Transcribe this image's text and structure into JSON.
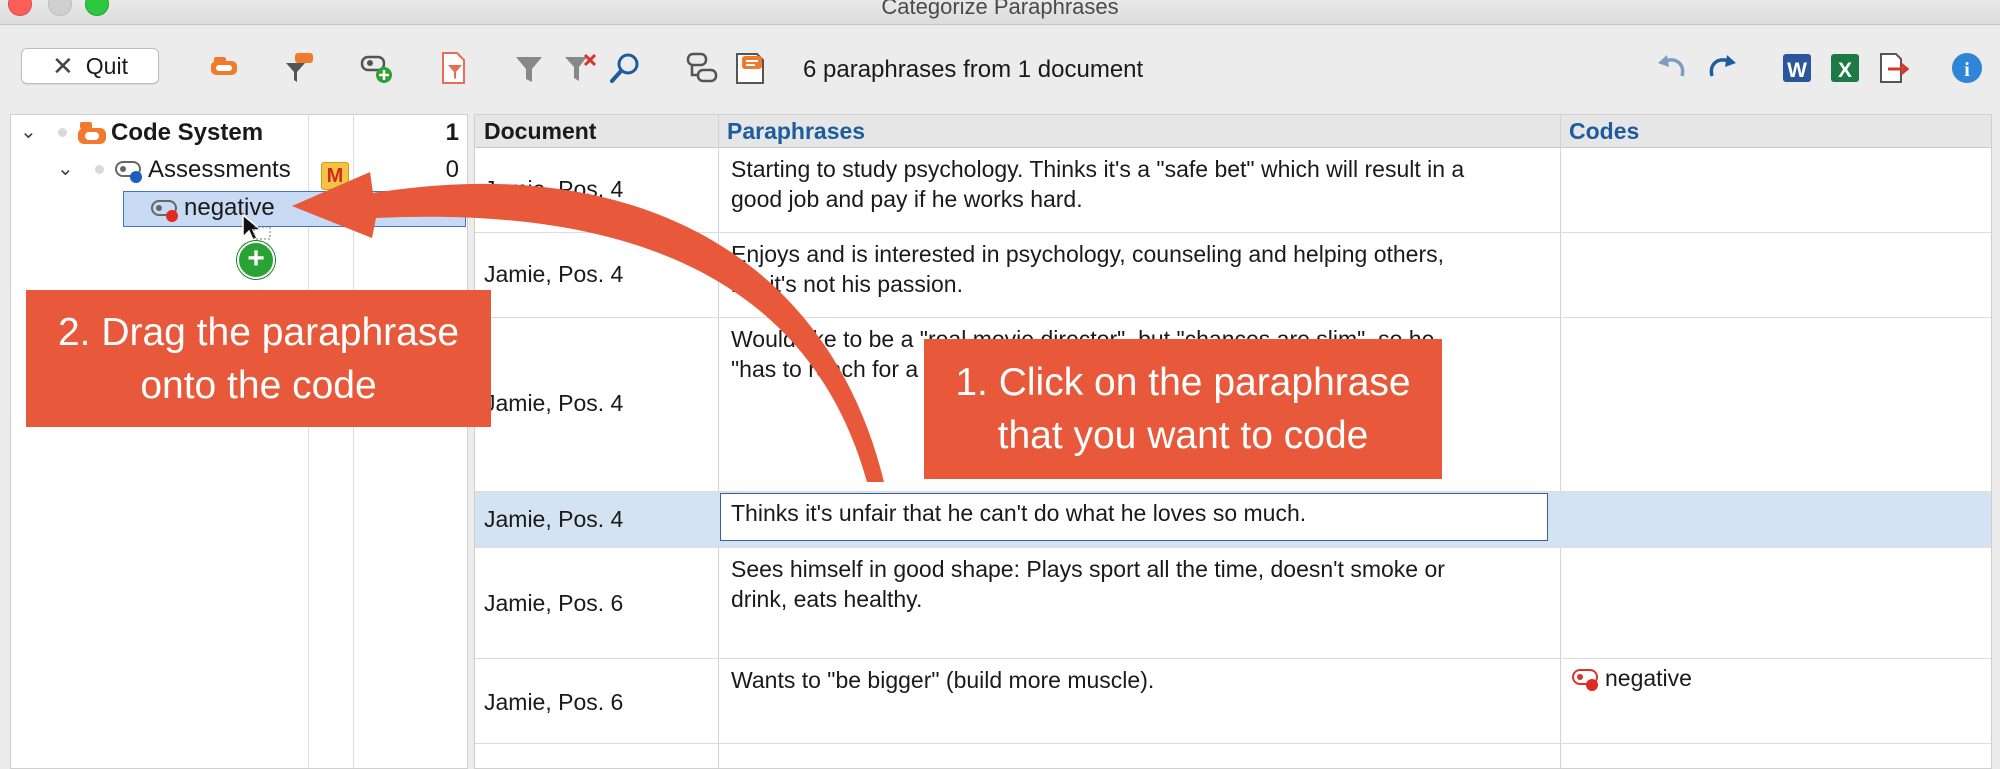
{
  "window": {
    "title": "Categorize Paraphrases"
  },
  "toolbar": {
    "quit_label": "Quit",
    "status": "6 paraphrases from 1 document",
    "icons": [
      "code-system-icon",
      "paraphrase-filter-icon",
      "new-code-icon",
      "document-filter-icon",
      "filter-icon",
      "clear-filter-icon",
      "search-icon",
      "code-link-icon",
      "paraphrase-doc-icon",
      "undo-icon",
      "redo-icon",
      "word-export-icon",
      "excel-export-icon",
      "export-icon",
      "info-icon"
    ],
    "accent_colors": {
      "orange": "#e8583a",
      "blue": "#1d5d9e",
      "word": "#2b579a",
      "excel": "#1d7a44"
    }
  },
  "code_system": {
    "root": {
      "label": "Code System",
      "count": "1"
    },
    "assessments": {
      "label": "Assessments",
      "badge": "M",
      "count": "0"
    },
    "negative": {
      "label": "negative",
      "count": "1"
    }
  },
  "table": {
    "headers": {
      "document": "Document",
      "paraphrases": "Paraphrases",
      "codes": "Codes"
    },
    "rows": [
      {
        "document": "Jamie, Pos. 4",
        "paraphrase_l1": "Starting to study psychology. Thinks it's a \"safe bet\" which will result in a",
        "paraphrase_l2": "good job and pay if he works hard.",
        "code": ""
      },
      {
        "document": "Jamie, Pos. 4",
        "paraphrase_l1": "Enjoys and is interested in psychology, counseling and helping others,",
        "paraphrase_l2": "but it's not his passion.",
        "code": ""
      },
      {
        "document": "Jamie, Pos. 4",
        "paraphrase_l1": "Would like to be a \"real movie director\", but \"chances are slim\", so he",
        "paraphrase_l2": "\"has to reach for a more realistic goal\" - so he is studying psychology.",
        "code": ""
      },
      {
        "document": "Jamie, Pos. 4",
        "paraphrase_l1": "Thinks it's unfair that he can't do what he loves so much.",
        "paraphrase_l2": "",
        "code": ""
      },
      {
        "document": "Jamie, Pos. 6",
        "paraphrase_l1": "Sees himself in good shape: Plays sport all the time, doesn't smoke or",
        "paraphrase_l2": "drink, eats healthy.",
        "code": ""
      },
      {
        "document": "Jamie, Pos. 6",
        "paraphrase_l1": "Wants to \"be bigger\" (build more muscle).",
        "paraphrase_l2": "",
        "code": "negative"
      }
    ]
  },
  "callouts": {
    "drag_l1": "2. Drag the paraphrase",
    "drag_l2": "onto the code",
    "click_l1": "1. Click on the paraphrase",
    "click_l2": "that you want to code"
  }
}
